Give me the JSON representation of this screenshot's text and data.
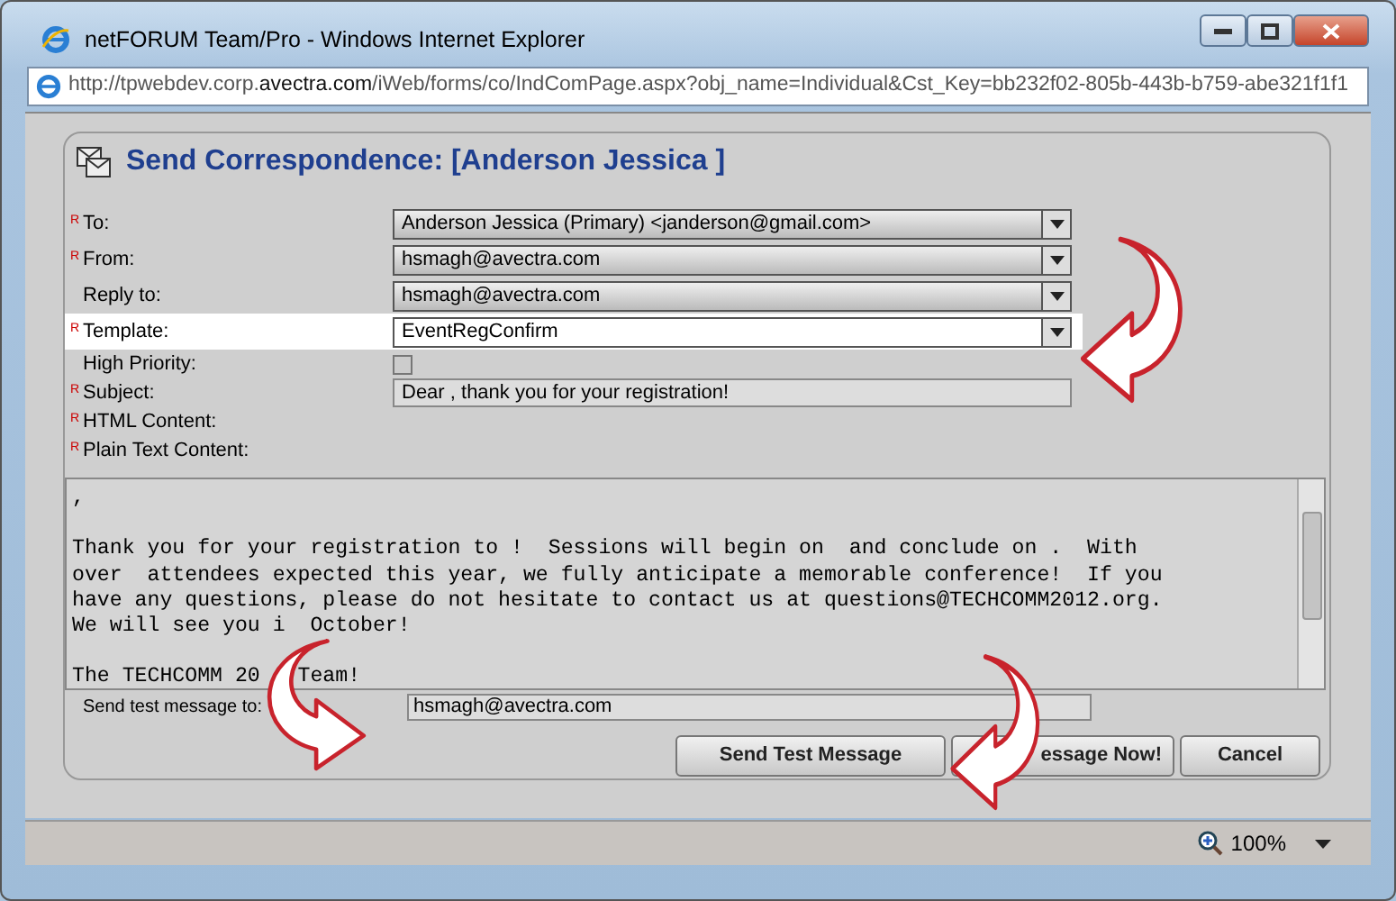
{
  "window": {
    "title": "netFORUM Team/Pro - Windows Internet Explorer",
    "address": "http://tpwebdev.corp.**avectra.com**/iWeb/forms/co/IndComPage.aspx?obj_name=Individual&Cst_Key=bb232f02-805b-443b-b759-abe321f1f1"
  },
  "panel": {
    "title": "Send Correspondence: [Anderson Jessica ]"
  },
  "fields": [
    {
      "label": "To:",
      "required_mark": "R",
      "kind": "select",
      "value": "Anderson Jessica (Primary) <janderson@gmail.com>",
      "highlighted": false
    },
    {
      "label": "From:",
      "required_mark": "R",
      "kind": "select",
      "value": "hsmagh@avectra.com",
      "highlighted": false
    },
    {
      "label": "Reply to:",
      "kind": "select",
      "value": "hsmagh@avectra.com",
      "highlighted": false
    },
    {
      "label": "Template:",
      "required_mark": "R",
      "kind": "select",
      "value": "EventRegConfirm",
      "highlighted": true
    },
    {
      "label": "High Priority:",
      "kind": "checkbox",
      "checked": false,
      "highlighted": false
    },
    {
      "label": "Subject:",
      "required_mark": "R",
      "kind": "text",
      "value": "Dear , thank you for your registration!",
      "highlighted": false
    },
    {
      "label": "HTML Content:",
      "required_mark": "R",
      "kind": "label",
      "highlighted": false
    },
    {
      "label": "Plain Text Content:",
      "required_mark": "R",
      "kind": "label",
      "highlighted": false
    }
  ],
  "plain_text": [
    {
      "kind": "text",
      "parts": [
        ","
      ]
    },
    {
      "kind": "blank"
    },
    {
      "kind": "text",
      "parts": [
        "Thank you for your registration to !  Sessions will begin on  and conclude on .  With"
      ]
    },
    {
      "kind": "text",
      "parts": [
        "over  attendees expected this year, we fully anticipate a memorable conference!  If you"
      ]
    },
    {
      "kind": "text",
      "parts": [
        "have any questions, please do not hesitate to contact us at questions@TECHCOMM2012.org."
      ]
    },
    {
      "kind": "text",
      "parts": [
        "We will see you i",
        "October!"
      ]
    },
    {
      "kind": "blank"
    },
    {
      "kind": "text",
      "parts": [
        "The TECHCOMM 20",
        "Team!"
      ]
    }
  ],
  "test_message": {
    "label": "Send test message to:",
    "value": "hsmagh@avectra.com"
  },
  "buttons": [
    "Send Test Message",
    "essage Now!",
    "Cancel"
  ],
  "status_bar": {
    "zoom": "100%"
  }
}
